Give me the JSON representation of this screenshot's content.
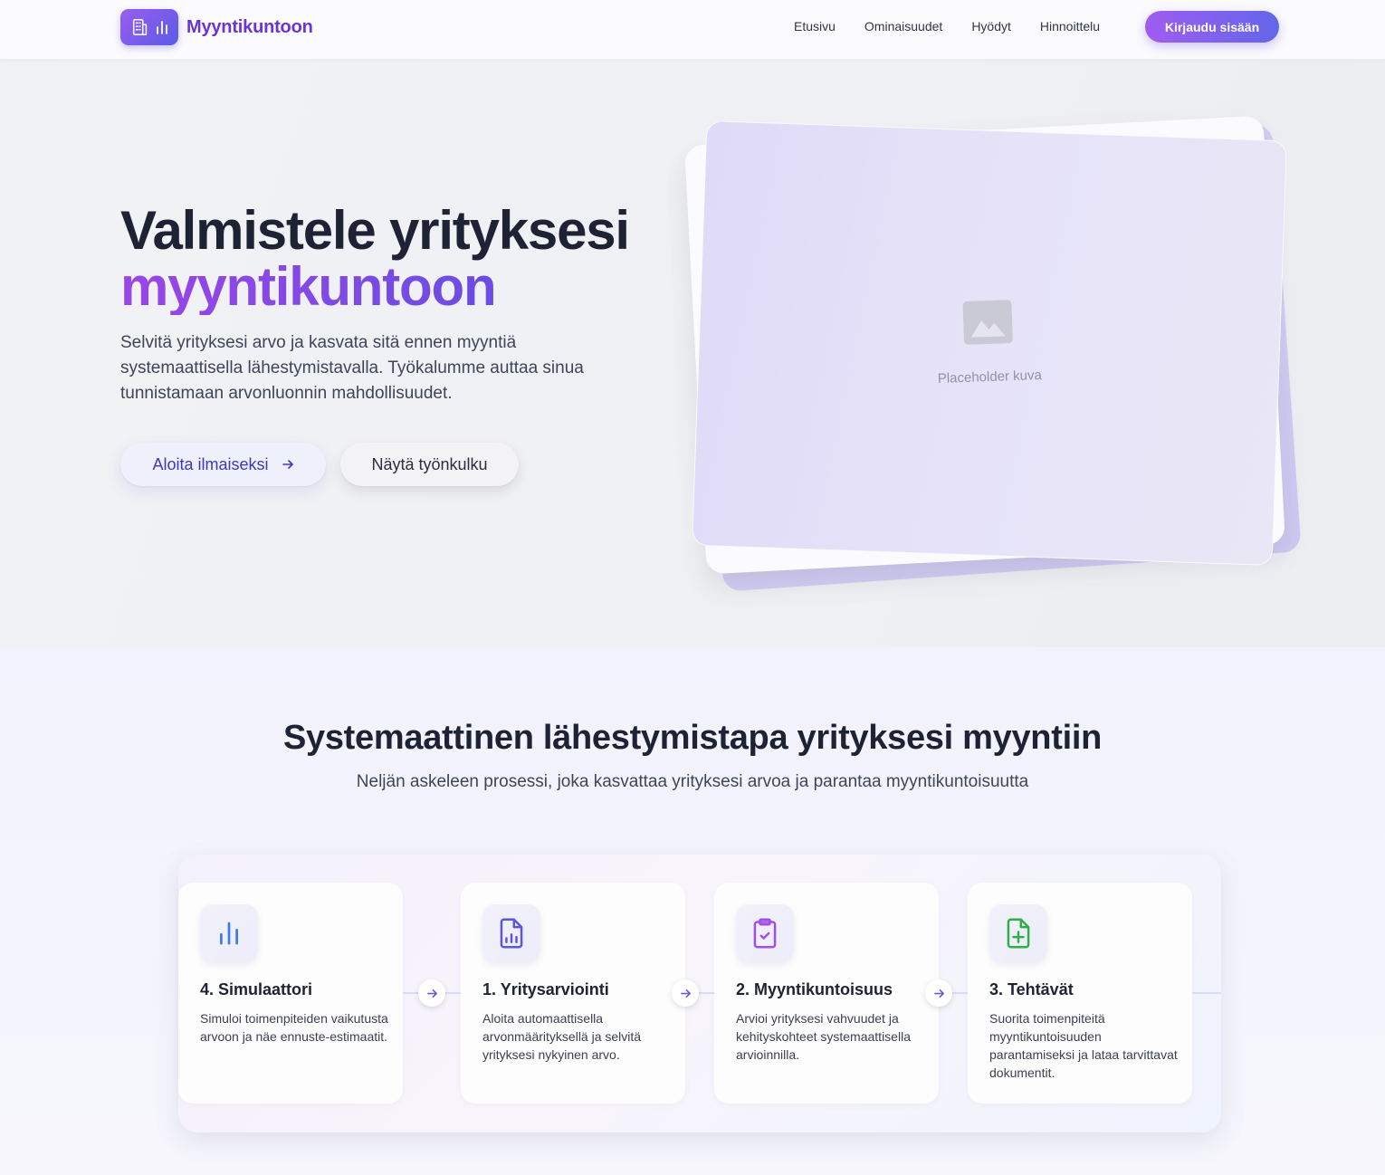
{
  "nav": {
    "brand": "Myyntikuntoon",
    "links": [
      "Etusivu",
      "Ominaisuudet",
      "Hyödyt",
      "Hinnoittelu"
    ],
    "login": "Kirjaudu sisään"
  },
  "hero": {
    "title_line1": "Valmistele yrityksesi",
    "title_line2": "myyntikuntoon",
    "description": "Selvitä yrityksesi arvo ja kasvata sitä ennen myyntiä systemaattisella lähestymistavalla. Työkalumme auttaa sinua tunnistamaan arvonluonnin mahdollisuudet.",
    "cta_primary": "Aloita ilmaiseksi",
    "cta_secondary": "Näytä työnkulku",
    "placeholder": "Placeholder kuva"
  },
  "process": {
    "title": "Systemaattinen lähestymistapa yrityksesi myyntiin",
    "subtitle": "Neljän askeleen prosessi, joka kasvattaa yrityksesi arvoa ja parantaa myyntikuntoisuutta",
    "steps": [
      {
        "title": "1. Yritysarviointi",
        "desc": "Aloita automaattisella arvonmäärityksellä ja selvitä yrityksesi nykyinen arvo.",
        "icon": "document-chart-icon",
        "color": "#5b55e0"
      },
      {
        "title": "2. Myyntikuntoisuus",
        "desc": "Arvioi yrityksesi vahvuudet ja kehityskohteet systemaattisella arvioinnilla.",
        "icon": "clipboard-check-icon",
        "color": "#a04fe6"
      },
      {
        "title": "3. Tehtävät",
        "desc": "Suorita toimenpiteitä myyntikuntoisuuden parantamiseksi ja lataa tarvittavat dokumentit.",
        "icon": "document-plus-icon",
        "color": "#2fae4a"
      },
      {
        "title": "4. Simulaattori",
        "desc": "Simuloi toimenpiteiden vaikutusta arvoon ja näe ennuste-estimaatit.",
        "icon": "bar-chart-icon",
        "color": "#3b7be3"
      }
    ]
  },
  "colors": {
    "accent_purple": "#9b45e8",
    "accent_indigo": "#5a4fe0"
  }
}
